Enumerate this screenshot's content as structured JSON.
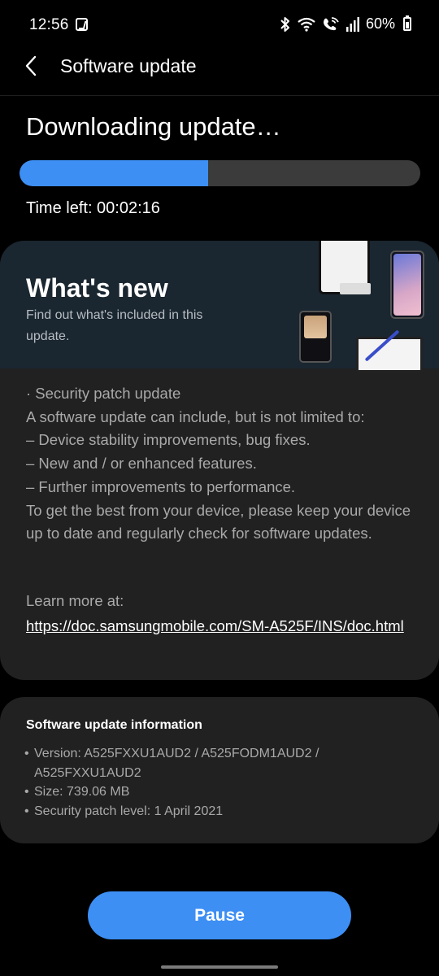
{
  "status_bar": {
    "time": "12:56",
    "battery": "60%",
    "icons": [
      "notification-icon",
      "bluetooth-icon",
      "wifi-icon",
      "wifi-calling-icon",
      "signal-icon",
      "battery-icon"
    ]
  },
  "app_bar": {
    "title": "Software update",
    "back_icon": "back-arrow-icon"
  },
  "download": {
    "title": "Downloading update…",
    "progress_fraction": 0.47,
    "time_left": "Time left: 00:02:16"
  },
  "whats_new": {
    "title": "What's new",
    "subtitle": "Find out what's included in this update.",
    "items": [
      "· Security patch update",
      "A software update can include, but is not limited to:",
      " – Device stability improvements, bug fixes.",
      " – New and / or enhanced features.",
      " – Further improvements to performance.",
      "To get the best from your device, please keep your device up to date and regularly check for software updates."
    ],
    "learn_more": "Learn more at:",
    "link": "https://doc.samsungmobile.com/SM-A525F/INS/doc.html"
  },
  "info": {
    "title": "Software update information",
    "items": [
      "Version: A525FXXU1AUD2 / A525FODM1AUD2 / A525FXXU1AUD2",
      "Size: 739.06 MB",
      "Security patch level: 1 April 2021"
    ]
  },
  "actions": {
    "pause_label": "Pause"
  },
  "colors": {
    "accent": "#3d8ff4",
    "background": "#000000",
    "card": "#212121",
    "banner": "#1a2630"
  }
}
